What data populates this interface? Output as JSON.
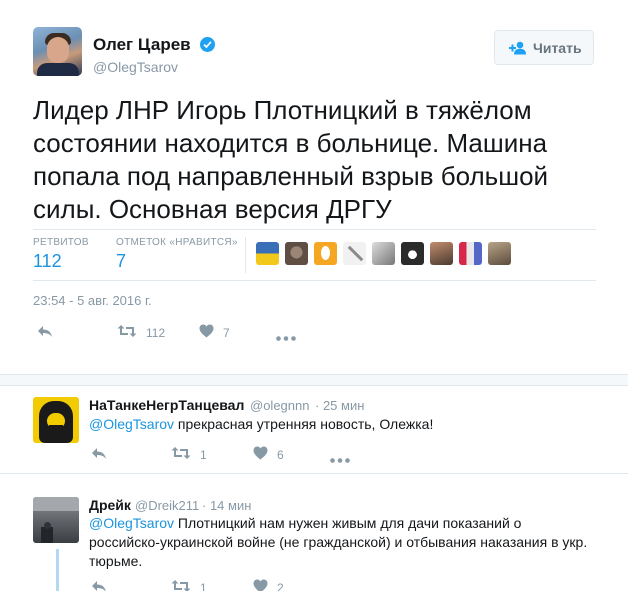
{
  "tweet": {
    "author_name": "Олег Царев",
    "author_handle": "@OlegTsarov",
    "follow_label": "Читать",
    "text": "Лидер ЛНР Игорь Плотницкий в тяжёлом состоянии находится в больнице. Машина попала под направленный взрыв большой силы. Основная версия ДРГУ",
    "retweets_label": "РЕТВИТОВ",
    "retweets_count": "112",
    "likes_label": "ОТМЕТОК «НРАВИТСЯ»",
    "likes_count": "7",
    "timestamp": "23:54 - 5 авг. 2016 г.",
    "actions": {
      "retweet_count": "112",
      "like_count": "7"
    }
  },
  "replies": [
    {
      "name": "НаТанкеНегрТанцевал",
      "handle": "@olegnnn",
      "time": "· 25 мин",
      "mention": "@OlegTsarov",
      "text": " прекрасная утренняя новость, Олежка!",
      "retweet_count": "1",
      "like_count": "6"
    },
    {
      "name": "Дрейк",
      "handle": "@Dreik211",
      "time": "· 14 мин",
      "mention": "@OlegTsarov",
      "text_line1": " Плотницкий нам нужен живым для дачи показаний о",
      "text_line2": "российско-украинской войне (не гражданской) и отбывания наказания в укр.",
      "text_line3": "тюрьме.",
      "retweet_count": "1",
      "like_count": "2"
    }
  ],
  "colors": {
    "accent": "#1b95e0",
    "muted": "#8899a6",
    "verified": "#1da1f2"
  }
}
